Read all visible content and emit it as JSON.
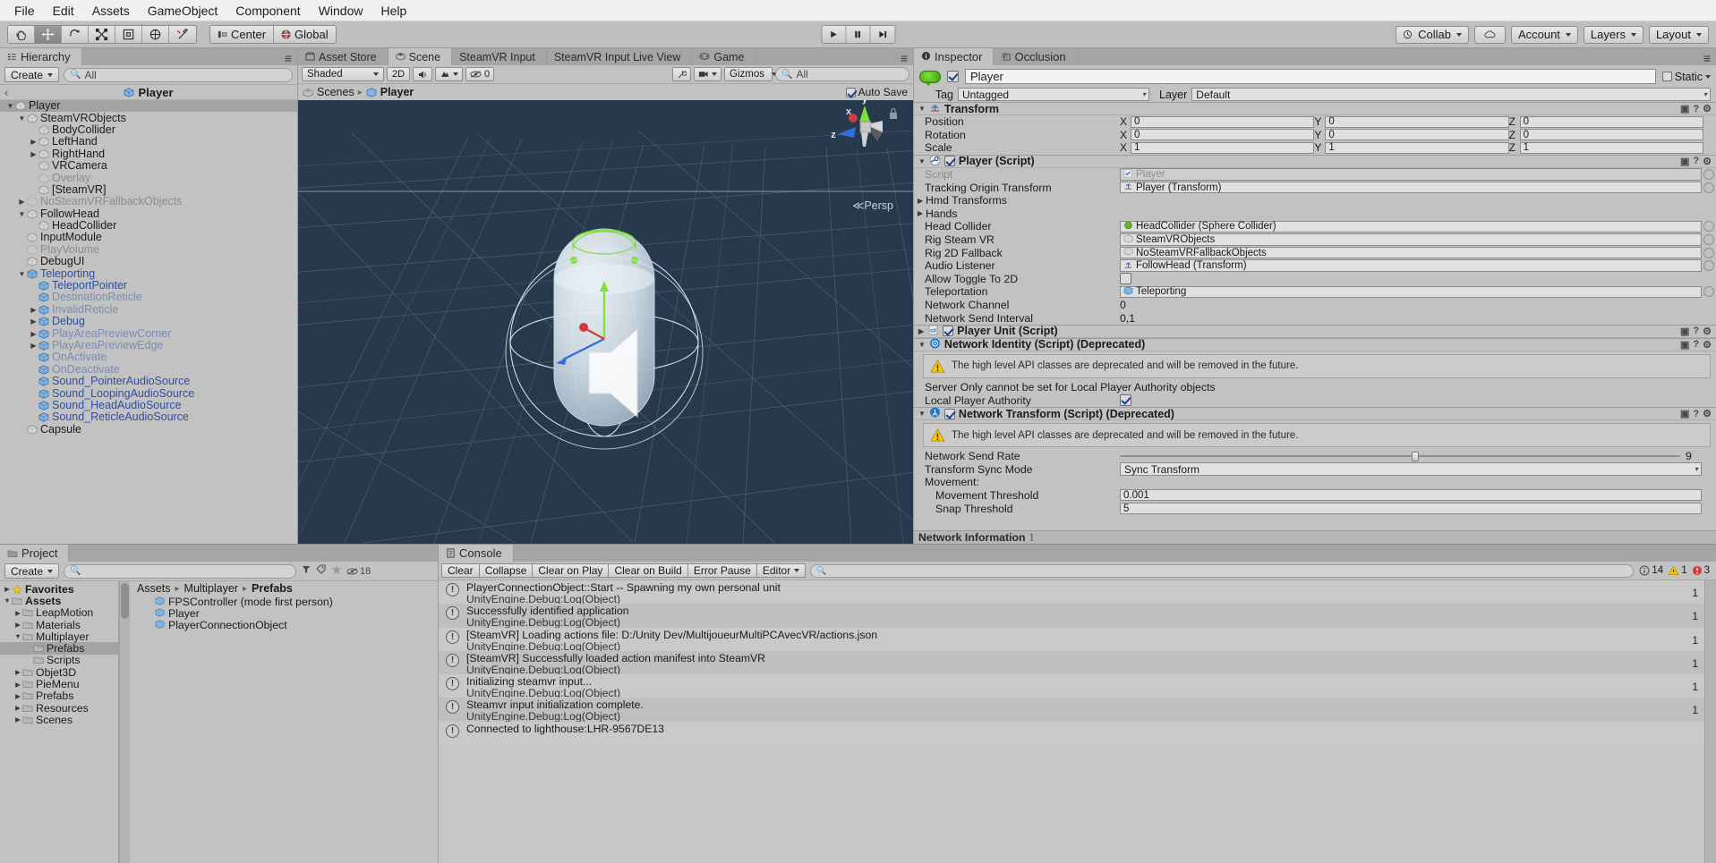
{
  "menubar": {
    "items": [
      "File",
      "Edit",
      "Assets",
      "GameObject",
      "Component",
      "Window",
      "Help"
    ]
  },
  "toolbar": {
    "tools": [
      "hand-tool",
      "move-tool",
      "rotate-tool",
      "scale-tool",
      "rect-tool",
      "transform-tool",
      "custom-tool"
    ],
    "pivot": "Center",
    "space": "Global",
    "play": "play-button",
    "pause": "pause-button",
    "step": "step-button",
    "collab": "Collab",
    "cloud": "cloud-icon",
    "account": "Account",
    "layers": "Layers",
    "layout": "Layout"
  },
  "hierarchy": {
    "tab": "Hierarchy",
    "create": "Create",
    "search_placeholder": "All",
    "breadcrumb": "Player",
    "items": [
      {
        "label": "Player",
        "depth": 0,
        "arrow": "down",
        "state": "selected",
        "style": "normal"
      },
      {
        "label": "SteamVRObjects",
        "depth": 1,
        "arrow": "down",
        "state": "",
        "style": "normal"
      },
      {
        "label": "BodyCollider",
        "depth": 2,
        "arrow": "none",
        "state": "",
        "style": "normal"
      },
      {
        "label": "LeftHand",
        "depth": 2,
        "arrow": "right",
        "state": "",
        "style": "normal"
      },
      {
        "label": "RightHand",
        "depth": 2,
        "arrow": "right",
        "state": "",
        "style": "normal"
      },
      {
        "label": "VRCamera",
        "depth": 2,
        "arrow": "none",
        "state": "",
        "style": "normal"
      },
      {
        "label": "Overlay",
        "depth": 2,
        "arrow": "none",
        "state": "",
        "style": "dim"
      },
      {
        "label": "[SteamVR]",
        "depth": 2,
        "arrow": "none",
        "state": "",
        "style": "normal"
      },
      {
        "label": "NoSteamVRFallbackObjects",
        "depth": 1,
        "arrow": "right",
        "state": "",
        "style": "dim"
      },
      {
        "label": "FollowHead",
        "depth": 1,
        "arrow": "down",
        "state": "",
        "style": "normal"
      },
      {
        "label": "HeadCollider",
        "depth": 2,
        "arrow": "none",
        "state": "",
        "style": "normal"
      },
      {
        "label": "InputModule",
        "depth": 1,
        "arrow": "none",
        "state": "",
        "style": "normal"
      },
      {
        "label": "PlayVolume",
        "depth": 1,
        "arrow": "none",
        "state": "",
        "style": "dim"
      },
      {
        "label": "DebugUI",
        "depth": 1,
        "arrow": "none",
        "state": "",
        "style": "normal"
      },
      {
        "label": "Teleporting",
        "depth": 1,
        "arrow": "down",
        "state": "",
        "style": "prefab"
      },
      {
        "label": "TeleportPointer",
        "depth": 2,
        "arrow": "none",
        "state": "",
        "style": "prefab"
      },
      {
        "label": "DestinationReticle",
        "depth": 2,
        "arrow": "none",
        "state": "",
        "style": "prefabdim"
      },
      {
        "label": "InvalidReticle",
        "depth": 2,
        "arrow": "right",
        "state": "",
        "style": "prefabdim"
      },
      {
        "label": "Debug",
        "depth": 2,
        "arrow": "right",
        "state": "",
        "style": "prefab"
      },
      {
        "label": "PlayAreaPreviewCorner",
        "depth": 2,
        "arrow": "right",
        "state": "",
        "style": "prefabdim"
      },
      {
        "label": "PlayAreaPreviewEdge",
        "depth": 2,
        "arrow": "right",
        "state": "",
        "style": "prefabdim"
      },
      {
        "label": "OnActivate",
        "depth": 2,
        "arrow": "none",
        "state": "",
        "style": "prefabdim"
      },
      {
        "label": "OnDeactivate",
        "depth": 2,
        "arrow": "none",
        "state": "",
        "style": "prefabdim"
      },
      {
        "label": "Sound_PointerAudioSource",
        "depth": 2,
        "arrow": "none",
        "state": "",
        "style": "prefab"
      },
      {
        "label": "Sound_LoopingAudioSource",
        "depth": 2,
        "arrow": "none",
        "state": "",
        "style": "prefab"
      },
      {
        "label": "Sound_HeadAudioSource",
        "depth": 2,
        "arrow": "none",
        "state": "",
        "style": "prefab"
      },
      {
        "label": "Sound_ReticleAudioSource",
        "depth": 2,
        "arrow": "none",
        "state": "",
        "style": "prefab"
      },
      {
        "label": "Capsule",
        "depth": 1,
        "arrow": "none",
        "state": "",
        "style": "normal"
      }
    ]
  },
  "scene": {
    "tabs": [
      {
        "label": "Asset Store",
        "icon": "store-icon",
        "selected": false
      },
      {
        "label": "Scene",
        "icon": "scene-icon",
        "selected": true
      },
      {
        "label": "SteamVR Input",
        "icon": "",
        "selected": false
      },
      {
        "label": "SteamVR Input Live View",
        "icon": "",
        "selected": false
      },
      {
        "label": "Game",
        "icon": "game-icon",
        "selected": false
      }
    ],
    "shading": "Shaded",
    "mode_2d": "2D",
    "audio_icon": "audio-icon",
    "fx_icon": "fx-icon",
    "gizmo_count": "0",
    "gizmos": "Gizmos",
    "gizmo_search_placeholder": "All",
    "breadcrumb_scenes": "Scenes",
    "breadcrumb_object": "Player",
    "auto_save": "Auto Save",
    "perspective": "Persp",
    "axis_x": "x",
    "axis_y": "y",
    "axis_z": "z"
  },
  "inspector": {
    "tabs": [
      {
        "label": "Inspector",
        "selected": true
      },
      {
        "label": "Occlusion",
        "selected": false
      }
    ],
    "object_name": "Player",
    "object_enabled": true,
    "static_label": "Static",
    "tag_label": "Tag",
    "tag_value": "Untagged",
    "layer_label": "Layer",
    "layer_value": "Default",
    "components": [
      {
        "title": "Transform",
        "icon": "transform-icon",
        "expanded": true,
        "has_checkbox": false,
        "rows": [
          {
            "type": "vector3",
            "label": "Position",
            "x": "0",
            "y": "0",
            "z": "0"
          },
          {
            "type": "vector3",
            "label": "Rotation",
            "x": "0",
            "y": "0",
            "z": "0"
          },
          {
            "type": "vector3",
            "label": "Scale",
            "x": "1",
            "y": "1",
            "z": "1"
          }
        ]
      },
      {
        "title": "Player (Script)",
        "icon": "steamvr-icon",
        "expanded": true,
        "has_checkbox": true,
        "checked": true,
        "rows": [
          {
            "type": "object",
            "label": "Script",
            "value": "Player",
            "icon": "script-icon",
            "disabled": true
          },
          {
            "type": "object",
            "label": "Tracking Origin Transform",
            "value": "Player (Transform)",
            "icon": "transform-icon"
          },
          {
            "type": "foldout",
            "label": "Hmd Transforms"
          },
          {
            "type": "foldout",
            "label": "Hands"
          },
          {
            "type": "object",
            "label": "Head Collider",
            "value": "HeadCollider (Sphere Collider)",
            "icon": "sphere-icon"
          },
          {
            "type": "object",
            "label": "Rig Steam VR",
            "value": "SteamVRObjects",
            "icon": "cube-icon"
          },
          {
            "type": "object",
            "label": "Rig 2D Fallback",
            "value": "NoSteamVRFallbackObjects",
            "icon": "cube-icon"
          },
          {
            "type": "object",
            "label": "Audio Listener",
            "value": "FollowHead (Transform)",
            "icon": "transform-icon"
          },
          {
            "type": "checkbox",
            "label": "Allow Toggle To 2D",
            "checked": false
          },
          {
            "type": "object",
            "label": "Teleportation",
            "value": "Teleporting",
            "icon": "prefab-icon"
          },
          {
            "type": "text",
            "label": "Network Channel",
            "value": "0"
          },
          {
            "type": "text",
            "label": "Network Send Interval",
            "value": "0,1"
          }
        ]
      },
      {
        "title": "Player Unit (Script)",
        "icon": "csharp-icon",
        "expanded": false,
        "has_checkbox": true,
        "checked": true,
        "rows": []
      },
      {
        "title": "Network Identity (Script) (Deprecated)",
        "icon": "network-icon",
        "expanded": true,
        "has_checkbox": false,
        "warning": "The high level API classes are deprecated and will be removed in the future.",
        "rows": [
          {
            "type": "plain",
            "label": "Server Only cannot be set for Local Player Authority objects"
          },
          {
            "type": "checkbox",
            "label": "Local Player Authority",
            "checked": true
          }
        ]
      },
      {
        "title": "Network Transform (Script) (Deprecated)",
        "icon": "nettransform-icon",
        "expanded": true,
        "has_checkbox": true,
        "checked": true,
        "warning": "The high level API classes are deprecated and will be removed in the future.",
        "rows": [
          {
            "type": "slider",
            "label": "Network Send Rate",
            "value": "9",
            "pct": 52
          },
          {
            "type": "dropdown",
            "label": "Transform Sync Mode",
            "value": "Sync Transform"
          },
          {
            "type": "plain",
            "label": "Movement:"
          },
          {
            "type": "field",
            "label": "Movement Threshold",
            "value": "0.001",
            "indent": true
          },
          {
            "type": "field",
            "label": "Snap Threshold",
            "value": "5",
            "indent": true
          }
        ]
      }
    ],
    "footer": "Network Information"
  },
  "project": {
    "tab": "Project",
    "create": "Create",
    "search_placeholder": "",
    "badge_count": "18",
    "tree": [
      {
        "label": "Favorites",
        "depth": 0,
        "arrow": "right",
        "icon": "star",
        "bold": true
      },
      {
        "label": "Assets",
        "depth": 0,
        "arrow": "down",
        "icon": "folder",
        "bold": true
      },
      {
        "label": "LeapMotion",
        "depth": 1,
        "arrow": "right",
        "icon": "folder",
        "bold": false
      },
      {
        "label": "Materials",
        "depth": 1,
        "arrow": "right",
        "icon": "folder",
        "bold": false
      },
      {
        "label": "Multiplayer",
        "depth": 1,
        "arrow": "down",
        "icon": "folder",
        "bold": false
      },
      {
        "label": "Prefabs",
        "depth": 2,
        "arrow": "none",
        "icon": "folder",
        "bold": false,
        "selected": true
      },
      {
        "label": "Scripts",
        "depth": 2,
        "arrow": "none",
        "icon": "folder",
        "bold": false
      },
      {
        "label": "Objet3D",
        "depth": 1,
        "arrow": "right",
        "icon": "folder",
        "bold": false
      },
      {
        "label": "PieMenu",
        "depth": 1,
        "arrow": "right",
        "icon": "folder",
        "bold": false
      },
      {
        "label": "Prefabs",
        "depth": 1,
        "arrow": "right",
        "icon": "folder",
        "bold": false
      },
      {
        "label": "Resources",
        "depth": 1,
        "arrow": "right",
        "icon": "folder",
        "bold": false
      },
      {
        "label": "Scenes",
        "depth": 1,
        "arrow": "right",
        "icon": "folder",
        "bold": false
      }
    ],
    "breadcrumbs": [
      "Assets",
      "Multiplayer",
      "Prefabs"
    ],
    "assets": [
      {
        "label": "FPSController (mode first person)",
        "icon": "prefab-icon"
      },
      {
        "label": "Player",
        "icon": "prefab-icon"
      },
      {
        "label": "PlayerConnectionObject",
        "icon": "prefab-icon"
      }
    ]
  },
  "console": {
    "tab": "Console",
    "buttons": [
      "Clear",
      "Collapse",
      "Clear on Play",
      "Clear on Build",
      "Error Pause"
    ],
    "editor_dropdown": "Editor",
    "search_placeholder": "",
    "counts": {
      "info": "14",
      "warning": "1",
      "error": "3"
    },
    "logs": [
      {
        "line1": "PlayerConnectionObject::Start -- Spawning my own personal unit",
        "line2": "UnityEngine.Debug:Log(Object)",
        "count": "1",
        "type": "info"
      },
      {
        "line1": "Successfully identified application",
        "line2": "UnityEngine.Debug:Log(Object)",
        "count": "1",
        "type": "info"
      },
      {
        "line1": "[SteamVR] Loading actions file: D:/Unity Dev/MultijoueurMultiPCAvecVR/actions.json",
        "line2": "UnityEngine.Debug:Log(Object)",
        "count": "1",
        "type": "info"
      },
      {
        "line1": "[SteamVR] Successfully loaded action manifest into SteamVR",
        "line2": "UnityEngine.Debug:Log(Object)",
        "count": "1",
        "type": "info"
      },
      {
        "line1": "Initializing steamvr input...",
        "line2": "UnityEngine.Debug:Log(Object)",
        "count": "1",
        "type": "info"
      },
      {
        "line1": "Steamvr input initialization complete.",
        "line2": "UnityEngine.Debug:Log(Object)",
        "count": "1",
        "type": "info"
      },
      {
        "line1": "Connected to lighthouse:LHR-9567DE13",
        "line2": "",
        "count": "",
        "type": "info"
      }
    ]
  }
}
